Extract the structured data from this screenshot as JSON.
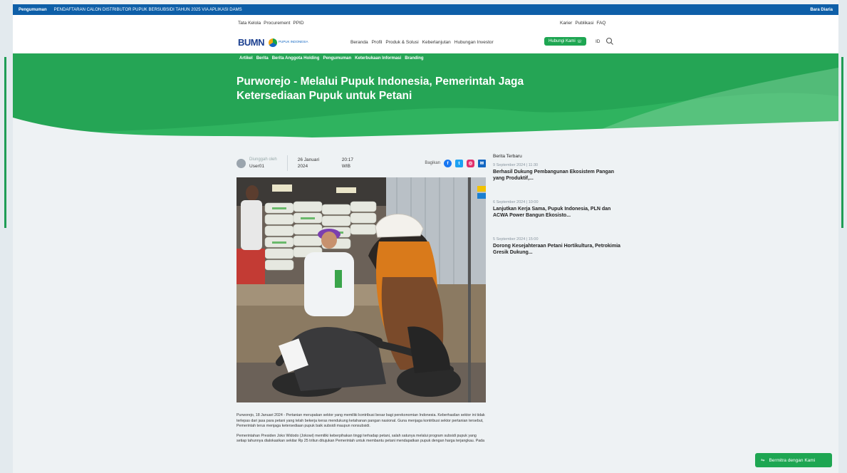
{
  "announcement": {
    "tag": "Pengumuman",
    "text": "PENDAFTARAN CALON DISTRIBUTOR PUPUK BERSUBSIDI TAHUN 2025 VIA APLIKASI DAMS",
    "lang_link": "Bara Diaria"
  },
  "header": {
    "util_links": [
      "Tata Kelola",
      "Procurement",
      "PPID"
    ],
    "util_right": [
      "Karier",
      "Publikasi",
      "FAQ"
    ],
    "logo_bumn": "BUMN",
    "logo_pi": "PUPUK INDONESIA",
    "nav": [
      "Beranda",
      "Profil",
      "Produk & Solusi",
      "Keberlanjutan",
      "Hubungan Investor"
    ],
    "cta": "Hubungi Kami",
    "lang": "ID"
  },
  "hero": {
    "subnav": [
      "Artikel",
      "Berita",
      "Berita Anggota Holding",
      "Pengumuman",
      "Keterbukaan Informasi",
      "Branding"
    ],
    "title": "Purworejo - Melalui Pupuk Indonesia, Pemerintah Jaga Ketersediaan Pupuk untuk Petani"
  },
  "meta": {
    "author_label": "Diunggah oleh",
    "author": "User01",
    "date": "26 Januari 2024",
    "time": "20:17 WIB",
    "share_label": "Bagikan"
  },
  "article": {
    "p1": "Purworejo, 18 Januari 2024 - Pertanian merupakan sektor yang memiliki kontribusi besar bagi perekonomian Indonesia. Keberhasilan sektor ini tidak terlepas dari jasa para petani yang telah bekerja keras mendukung ketahanan pangan nasional. Guna menjaga kontribusi sektor pertanian tersebut, Pemerintah terus menjaga ketersediaan pupuk baik subsidi maupun nonsubsidi.",
    "p2": "Pemerintahan Presiden Joko Widodo (Jokowi) memiliki keberpihakan tinggi terhadap petani, salah satunya melalui program subsidi pupuk yang setiap tahunnya dialokasikan sekitar Rp 25 triliun ditujukan Pemerintah untuk membantu petani mendapatkan pupuk dengan harga terjangkau. Pada"
  },
  "sidebar": {
    "heading": "Berita Terbaru",
    "items": [
      {
        "ts": "9 September 2024 | 11:30",
        "title": "Berhasil Dukung Pembangunan Ekosistem Pangan yang Produktif,..."
      },
      {
        "ts": "6 September 2024 | 10:00",
        "title": "Lanjutkan Kerja Sama, Pupuk Indonesia, PLN dan ACWA Power Bangun Ekosisto..."
      },
      {
        "ts": "5 September 2024 | 15:00",
        "title": "Dorong Kesejahteraan Petani Hortikultura, Petrokimia Gresik Dukung..."
      }
    ]
  },
  "chat": {
    "label": "Bermitra dengan Kami"
  },
  "colors": {
    "brand_green": "#1ea652",
    "announce_blue": "#0e5fa8"
  }
}
